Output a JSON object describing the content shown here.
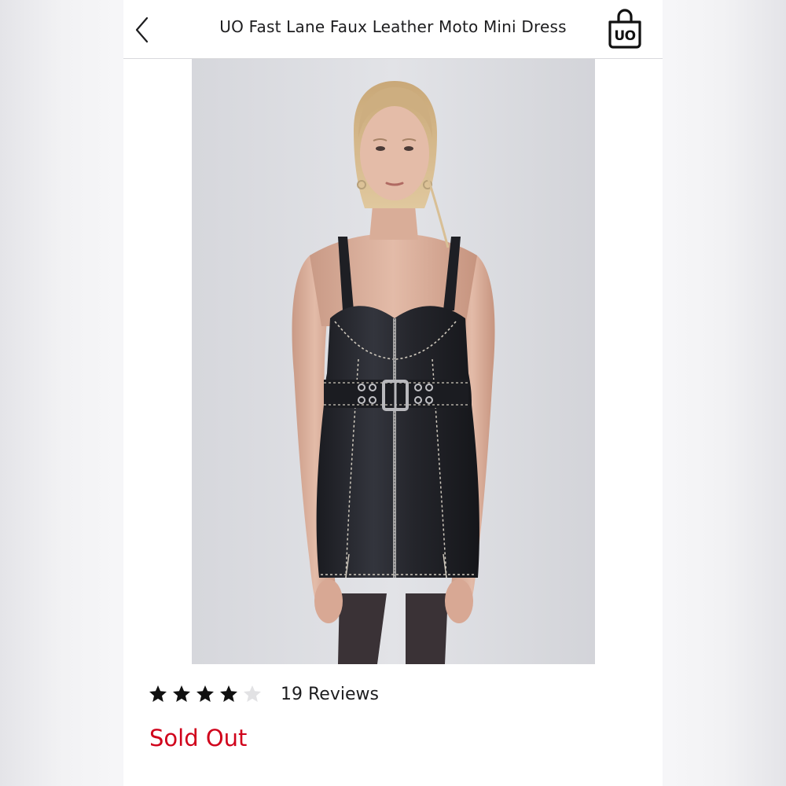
{
  "header": {
    "title": "UO Fast Lane Faux Leather Moto Mini Dress",
    "bag_logo_text": "UO"
  },
  "product": {
    "image_alt": "Model wearing black faux leather moto mini dress with front zip and belted waist"
  },
  "rating": {
    "stars_filled": 4,
    "stars_total": 5,
    "reviews_label": "19 Reviews"
  },
  "status": {
    "label": "Sold Out",
    "color": "#d0021b"
  },
  "icons": {
    "back": "chevron-left-icon",
    "bag": "shopping-bag-icon",
    "star_filled": "star-filled-icon",
    "star_empty": "star-empty-icon"
  }
}
